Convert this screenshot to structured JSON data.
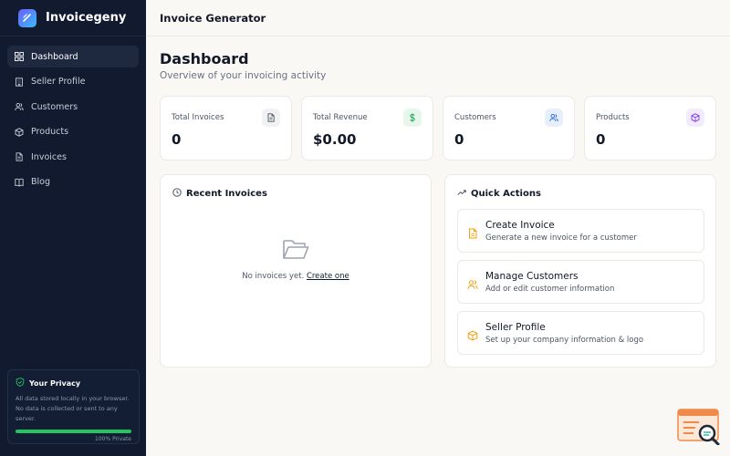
{
  "app": {
    "name": "Invoicegeny"
  },
  "sidebar": {
    "items": [
      {
        "label": "Dashboard",
        "icon": "grid-icon",
        "active": true
      },
      {
        "label": "Seller Profile",
        "icon": "building-icon"
      },
      {
        "label": "Customers",
        "icon": "users-icon"
      },
      {
        "label": "Products",
        "icon": "box-icon"
      },
      {
        "label": "Invoices",
        "icon": "file-icon"
      },
      {
        "label": "Blog",
        "icon": "book-icon"
      }
    ],
    "privacy": {
      "title": "Your Privacy",
      "text": "All data stored locally in your browser. No data is collected or sent to any server.",
      "progress": 1.0,
      "footer": "100% Private"
    }
  },
  "header": {
    "title": "Invoice Generator"
  },
  "main": {
    "title": "Dashboard",
    "subtitle": "Overview of your invoicing activity",
    "stats": [
      {
        "label": "Total Invoices",
        "value": "0",
        "icon": "document-icon",
        "color": "#4b5563"
      },
      {
        "label": "Total Revenue",
        "value": "$0.00",
        "icon": "dollar-icon",
        "color": "#16a34a"
      },
      {
        "label": "Customers",
        "value": "0",
        "icon": "users-icon",
        "color": "#2563eb"
      },
      {
        "label": "Products",
        "value": "0",
        "icon": "box-icon",
        "color": "#7c3aed"
      }
    ],
    "recent": {
      "title": "Recent Invoices",
      "empty_text": "No invoices yet.",
      "empty_link": "Create one"
    },
    "quick": {
      "title": "Quick Actions",
      "actions": [
        {
          "title": "Create Invoice",
          "subtitle": "Generate a new invoice for a customer",
          "icon": "document-icon"
        },
        {
          "title": "Manage Customers",
          "subtitle": "Add or edit customer information",
          "icon": "users-icon"
        },
        {
          "title": "Seller Profile",
          "subtitle": "Set up your company information & logo",
          "icon": "box-icon"
        }
      ]
    }
  },
  "colors": {
    "sidebar_bg": "#111a2e",
    "accent": "#f59e0b",
    "privacy_bar": "#22c55e"
  }
}
